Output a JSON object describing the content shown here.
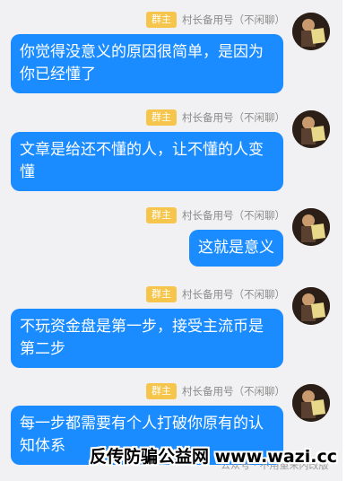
{
  "group": {
    "role_badge": "群主",
    "sender_name": "村长备用号（不闲聊）"
  },
  "messages": [
    {
      "text": "你觉得没意义的原因很简单，是因为你已经懂了"
    },
    {
      "text": "文章是给还不懂的人，让不懂的人变懂"
    },
    {
      "text": "这就是意义"
    },
    {
      "text": "不玩资金盘是第一步，接受主流币是第二步"
    },
    {
      "text": "每一步都需要有个人打破你原有的认知体系"
    }
  ],
  "watermark": {
    "main": "反传防骗公益网 www.wazi.cc",
    "sub": "公众号 · 不用重来内改版"
  }
}
